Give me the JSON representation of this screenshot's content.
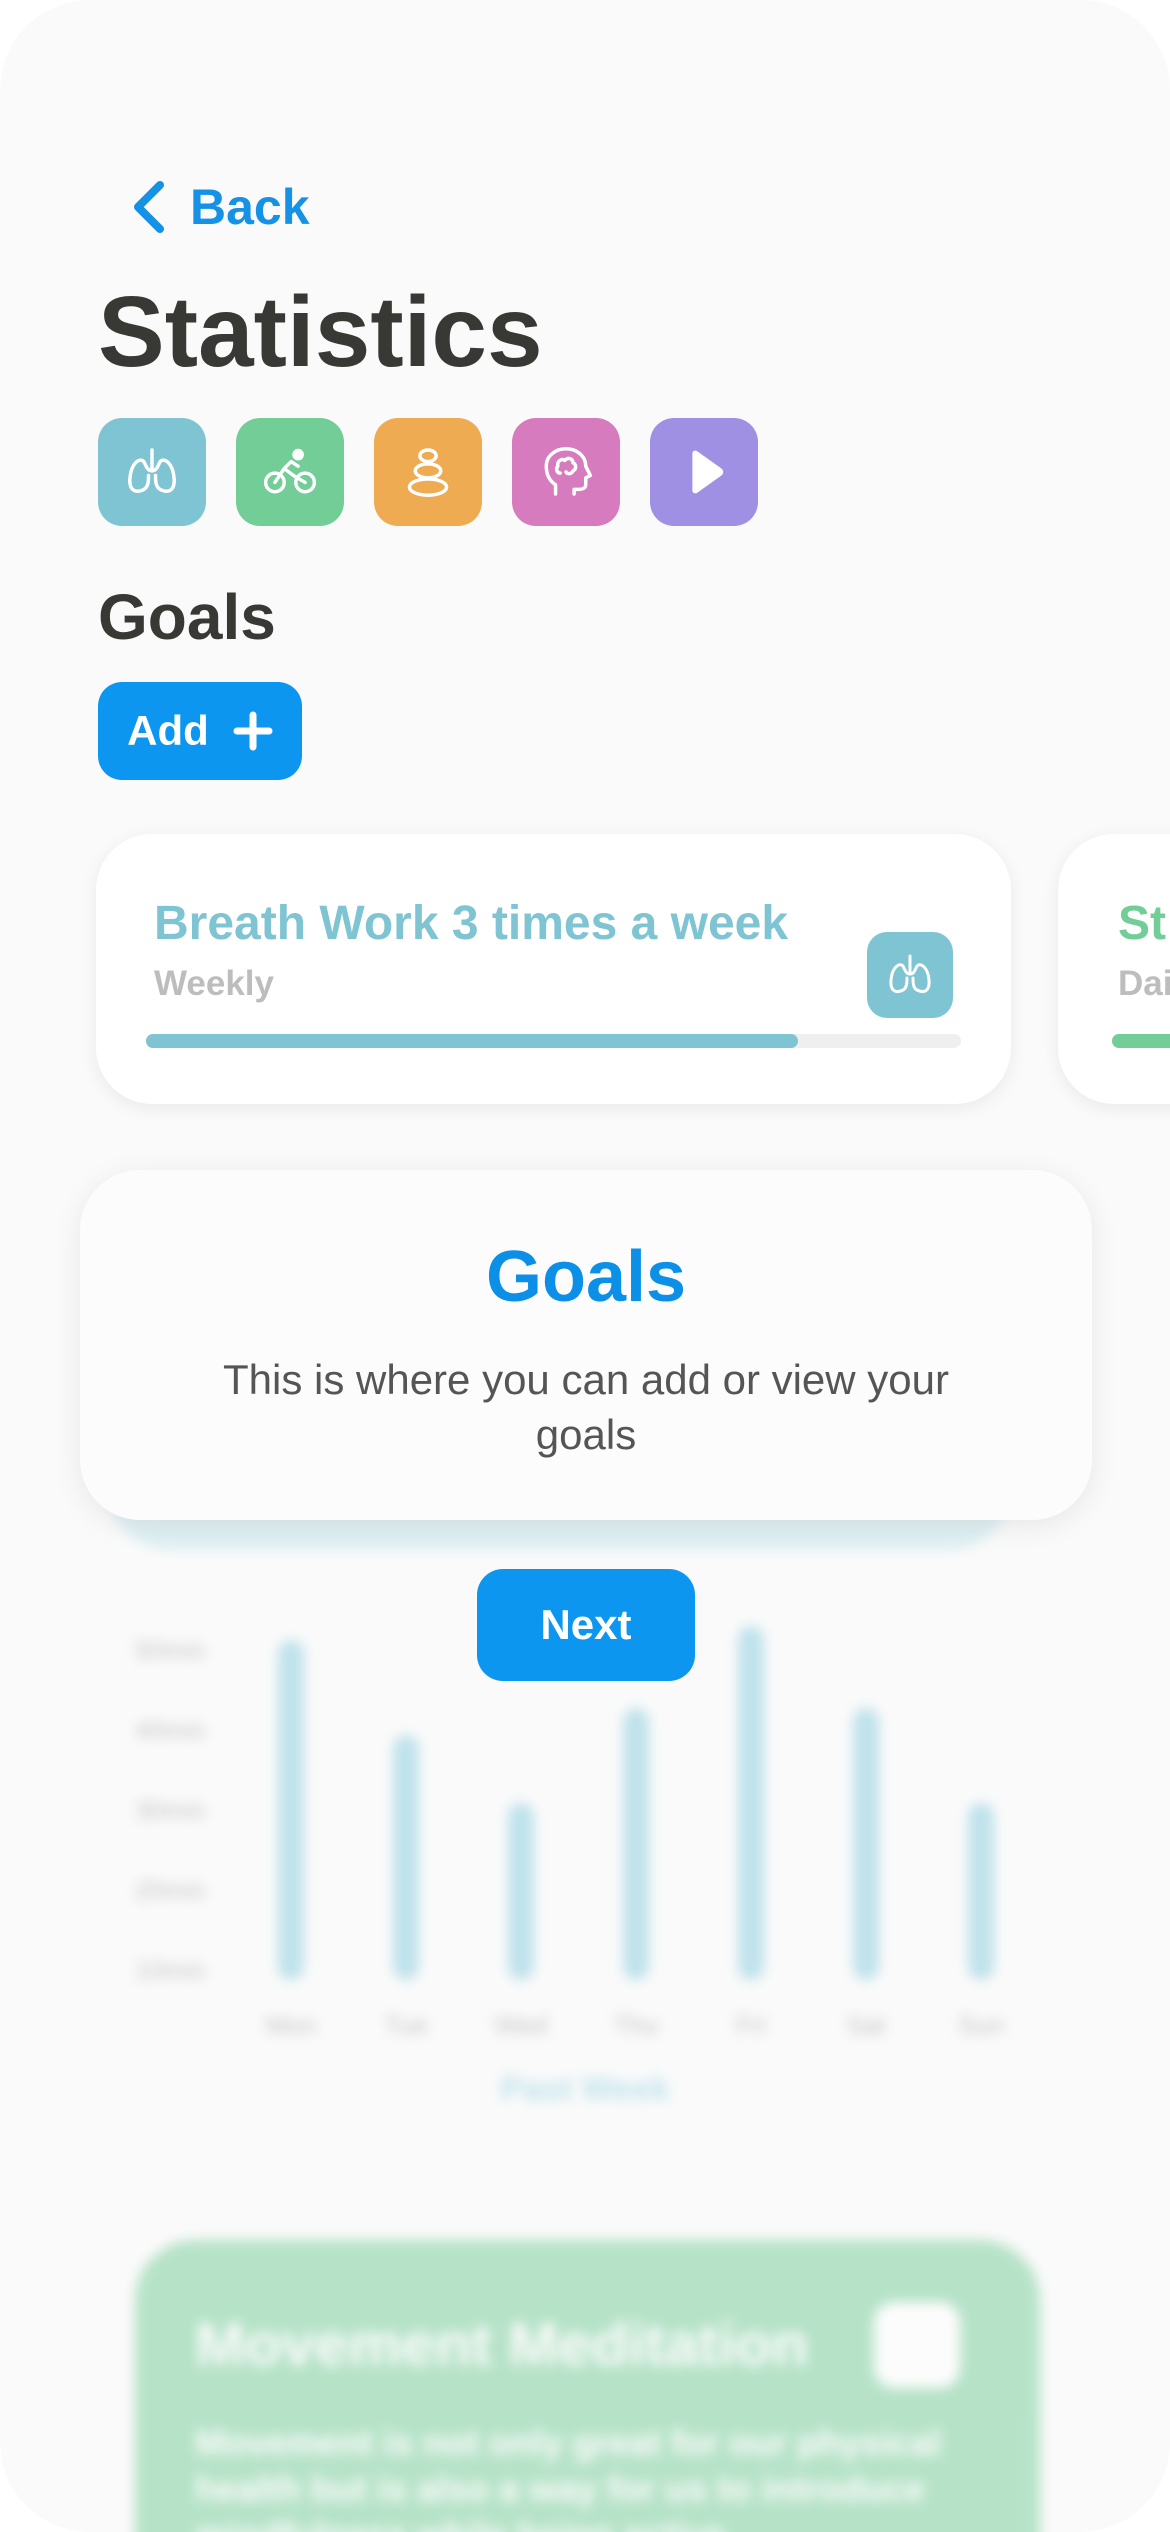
{
  "header": {
    "back_label": "Back",
    "title": "Statistics"
  },
  "categories": [
    {
      "name": "breath",
      "icon": "lungs-icon",
      "color": "#7fc4d2"
    },
    {
      "name": "movement",
      "icon": "cycling-icon",
      "color": "#72cd97"
    },
    {
      "name": "balance",
      "icon": "stones-icon",
      "color": "#eeab52"
    },
    {
      "name": "mind",
      "icon": "head-icon",
      "color": "#d77bbf"
    },
    {
      "name": "video",
      "icon": "play-icon",
      "color": "#9f90e4"
    }
  ],
  "goals": {
    "heading": "Goals",
    "add_label": "Add",
    "cards": [
      {
        "title": "Breath Work 3 times a week",
        "frequency": "Weekly",
        "color": "#7fc4d2",
        "progress": 0.8
      },
      {
        "title": "St",
        "frequency": "Dai",
        "color": "#72cd97",
        "progress": 0.6
      }
    ]
  },
  "chart_data": {
    "type": "bar",
    "categories": [
      "Mon",
      "Tue",
      "Wed",
      "Thu",
      "Fri",
      "Sat",
      "Sun"
    ],
    "values": [
      50,
      36,
      26,
      40,
      52,
      40,
      26
    ],
    "yticks": [
      "50min",
      "40min",
      "30min",
      "20min",
      "10min"
    ],
    "xlabel": "Past Week",
    "ylim": [
      0,
      50
    ],
    "color": "#8fcfe0"
  },
  "meditation_card": {
    "title": "Movement Meditation",
    "description": "Movement is not only great for our physical health but is also a way for us to introduce mindfulness while being active.",
    "color": "#7fd0a0"
  },
  "onboarding": {
    "title": "Goals",
    "text": "This is where you can add or view your goals",
    "next_label": "Next"
  },
  "colors": {
    "accent": "#0c96f0",
    "title_text": "#383835"
  }
}
